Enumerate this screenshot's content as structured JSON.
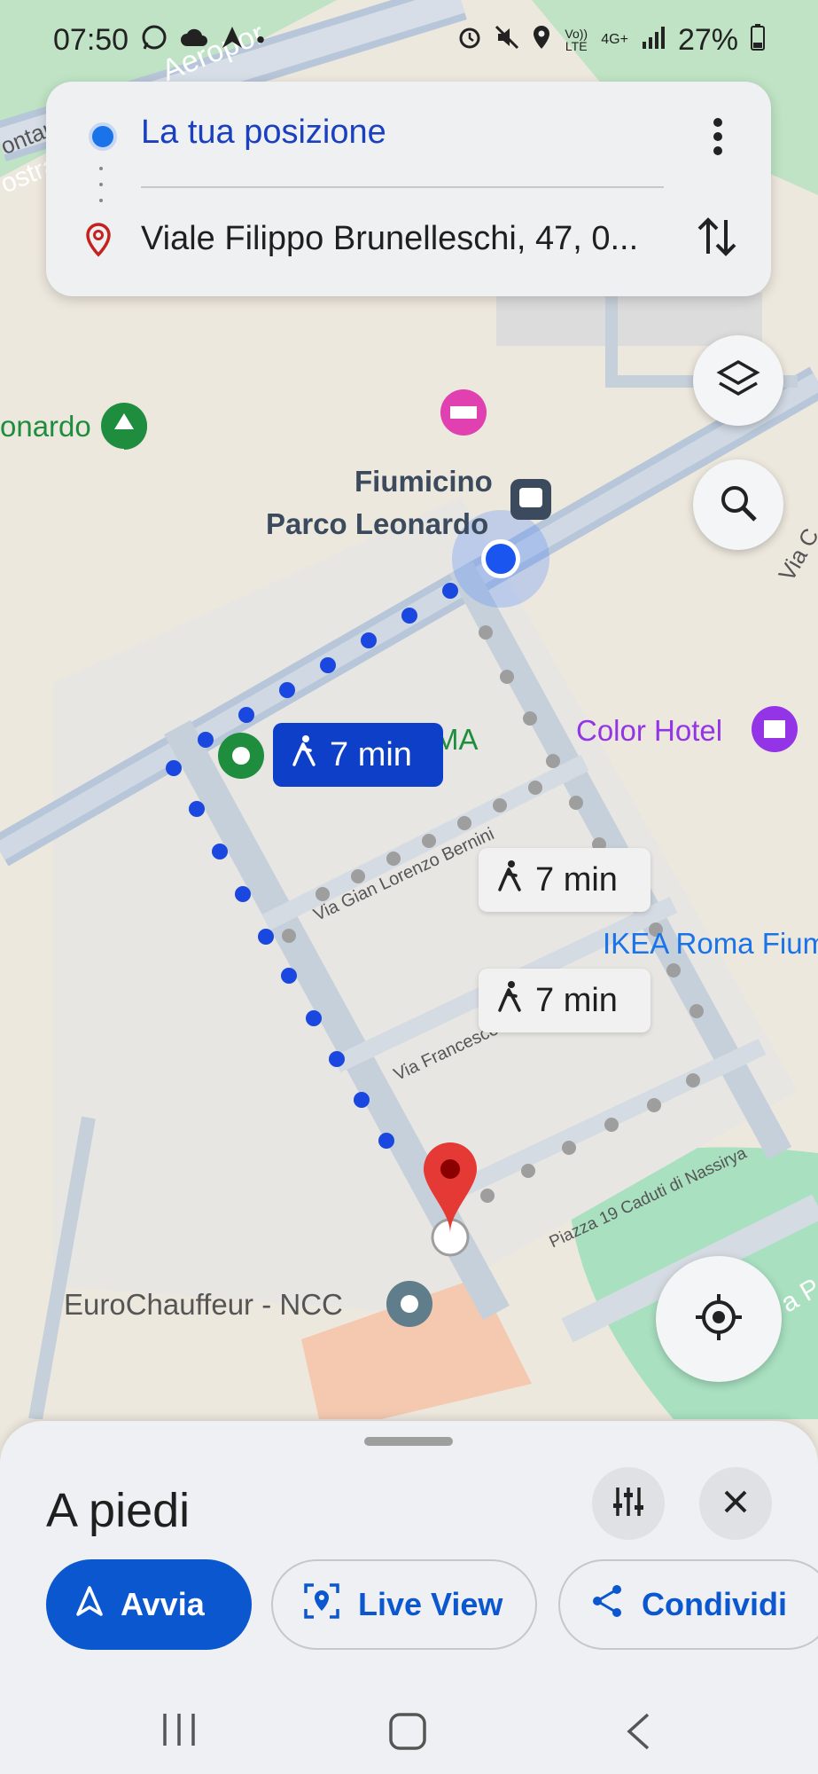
{
  "status_bar": {
    "time": "07:50",
    "left_icons": [
      "whatsapp-icon",
      "cloud-icon",
      "navigation-icon"
    ],
    "right_icons": [
      "alarm-icon",
      "mute-icon",
      "location-icon",
      "volte-icon",
      "4g-icon",
      "signal-icon"
    ],
    "volte": "Vo)) LTE",
    "network": "4G+",
    "battery": "27%"
  },
  "route_card": {
    "origin": "La tua posizione",
    "destination": "Viale Filippo Brunelleschi, 47, 0..."
  },
  "map": {
    "street_labels": {
      "aeroporto": "Aeropor",
      "ostra": "ostra",
      "contar": "ontar",
      "gian_lorenzo": "Via Gian Lorenzo Bernini",
      "francesco": "Via Francesco",
      "caduti": "Piazza 19 Caduti di Nassirya",
      "via_c": "Via C",
      "a_po": "a Po"
    },
    "poi_labels": {
      "leonardo_park": "onardo",
      "station_line1": "Fiumicino",
      "station_line2": "Parco Leonardo",
      "ma": "MA",
      "color_hotel": "Color Hotel",
      "ikea": "IKEA Roma Fium",
      "eurochauffeur": "EuroChauffeur - NCC"
    },
    "route_pills": [
      {
        "label": "7 min",
        "selected": true
      },
      {
        "label": "7 min",
        "selected": false
      },
      {
        "label": "7 min",
        "selected": false
      }
    ]
  },
  "bottom_sheet": {
    "title": "A piedi",
    "buttons": {
      "start": "Avvia",
      "live_view": "Live View",
      "share": "Condividi"
    }
  },
  "colors": {
    "accent_blue": "#0b57d0",
    "route_blue": "#1a47e0",
    "alt_route_gray": "#9e9e9e",
    "destination_red": "#d32f2f",
    "park_green": "#a8e0c0"
  }
}
